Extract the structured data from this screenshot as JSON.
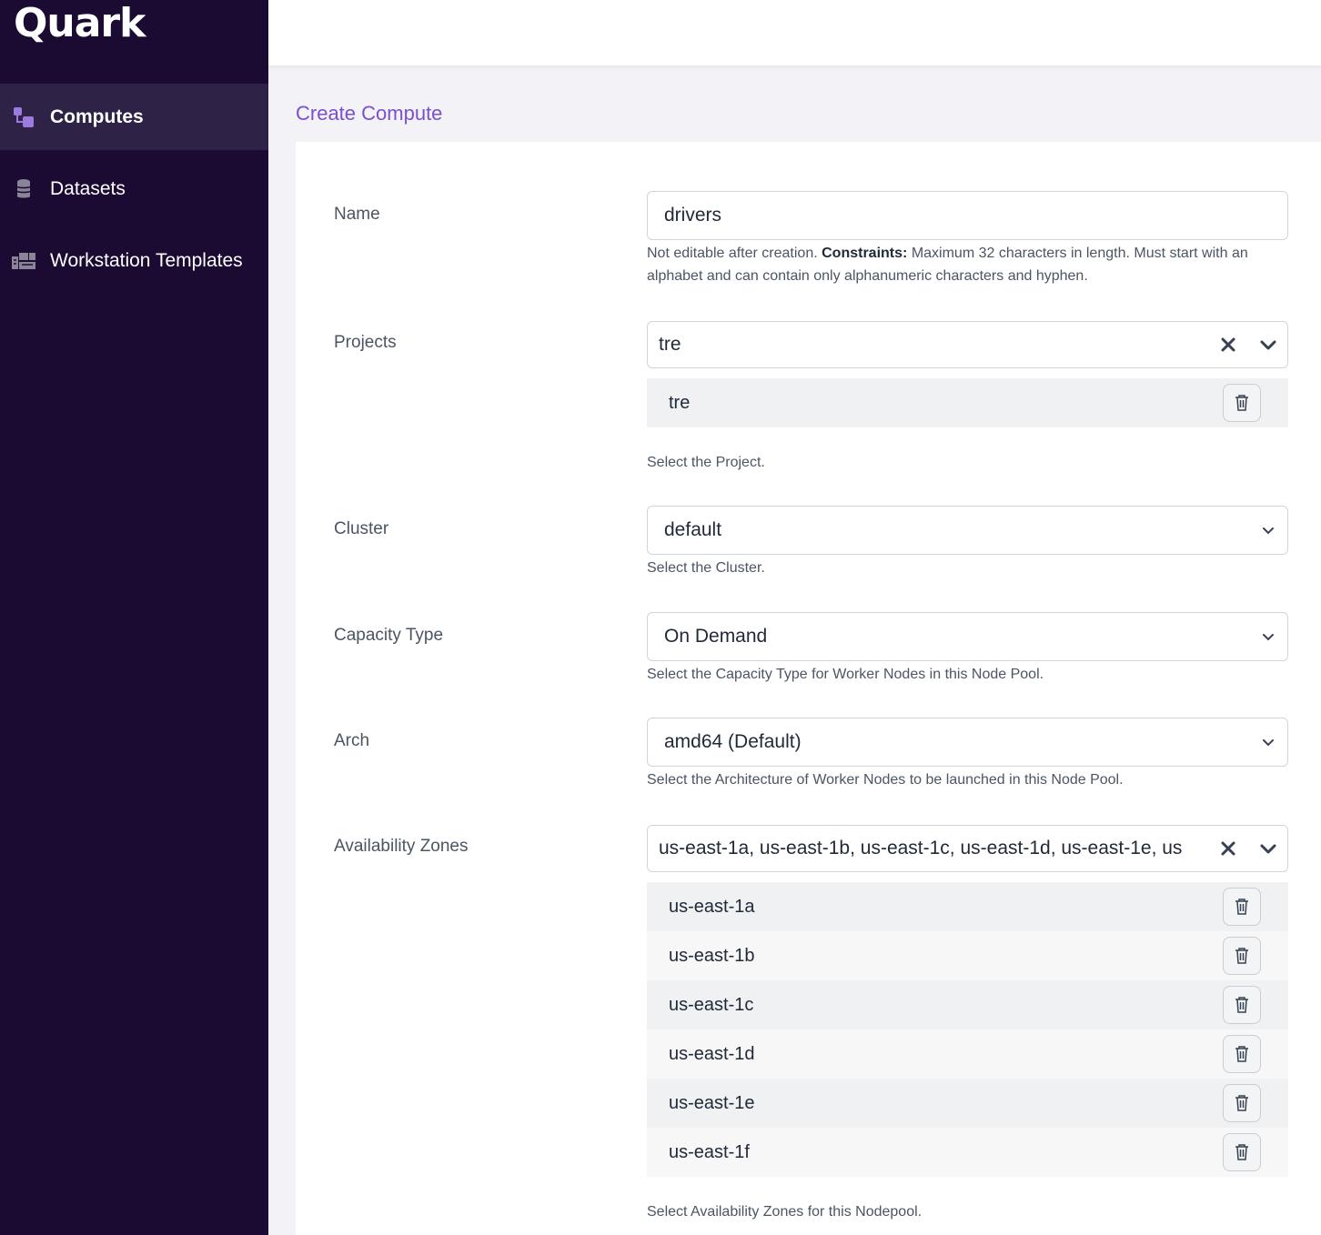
{
  "app": {
    "name": "Quark"
  },
  "sidebar": {
    "items": [
      {
        "label": "Computes",
        "icon": "computes-icon",
        "active": true
      },
      {
        "label": "Datasets",
        "icon": "database-icon",
        "active": false
      },
      {
        "label": "Workstation Templates",
        "icon": "templates-icon",
        "active": false
      }
    ]
  },
  "page": {
    "title": "Create Compute"
  },
  "form": {
    "name": {
      "label": "Name",
      "value": "drivers",
      "help_prefix": "Not editable after creation.",
      "help_bold": "Constraints:",
      "help_suffix": "Maximum 32 characters in length. Must start with an alphabet and can contain only alphanumeric characters and hyphen."
    },
    "projects": {
      "label": "Projects",
      "value": "tre",
      "selected": [
        "tre"
      ],
      "help": "Select the Project."
    },
    "cluster": {
      "label": "Cluster",
      "value": "default",
      "help": "Select the Cluster."
    },
    "capacity_type": {
      "label": "Capacity Type",
      "value": "On Demand",
      "help": "Select the Capacity Type for Worker Nodes in this Node Pool."
    },
    "arch": {
      "label": "Arch",
      "value": "amd64 (Default)",
      "help": "Select the Architecture of Worker Nodes to be launched in this Node Pool."
    },
    "availability_zones": {
      "label": "Availability Zones",
      "value": "us-east-1a, us-east-1b, us-east-1c, us-east-1d, us-east-1e, us",
      "selected": [
        "us-east-1a",
        "us-east-1b",
        "us-east-1c",
        "us-east-1d",
        "us-east-1e",
        "us-east-1f"
      ],
      "help": "Select Availability Zones for this Nodepool."
    }
  },
  "colors": {
    "sidebar_bg": "#1b0b33",
    "sidebar_active": "#2f2247",
    "accent": "#7a4fd0"
  }
}
